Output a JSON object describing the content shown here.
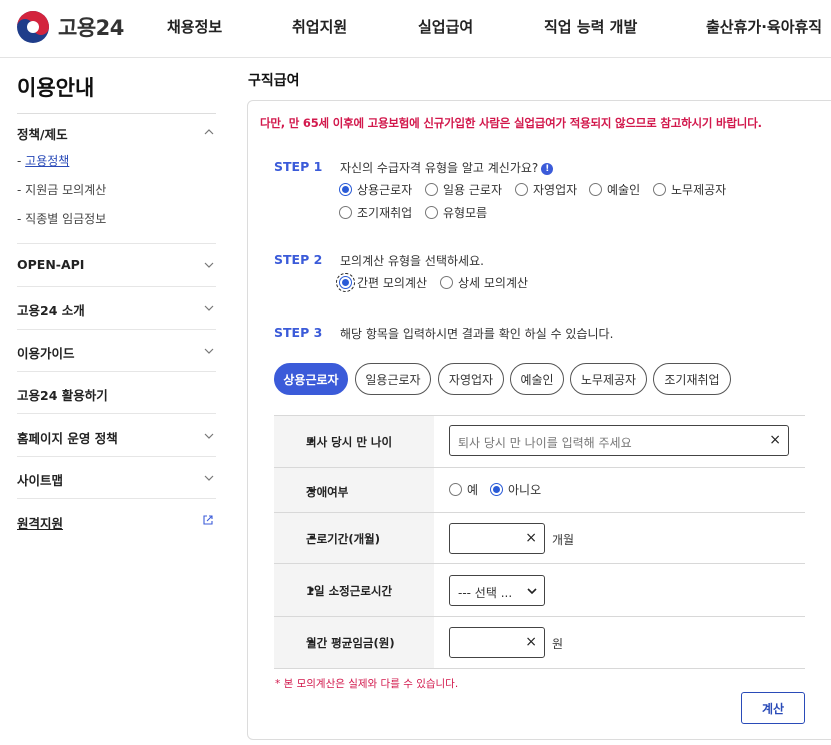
{
  "header": {
    "logo_text": "고용24",
    "nav": [
      "채용정보",
      "취업지원",
      "실업급여",
      "직업 능력 개발",
      "출산휴가·육아휴직"
    ]
  },
  "sidebar": {
    "title": "이용안내",
    "sections": [
      {
        "label": "정책/제도",
        "icon": "chevron-up-icon",
        "subs": [
          "고용정책",
          "지원금 모의계산",
          "직종별 임금정보"
        ]
      },
      {
        "label": "OPEN-API",
        "icon": "chevron-down-icon"
      },
      {
        "label": "고용24 소개",
        "icon": "chevron-down-icon"
      },
      {
        "label": "이용가이드",
        "icon": "chevron-down-icon"
      },
      {
        "label": "고용24 활용하기"
      },
      {
        "label": "홈페이지 운영 정책",
        "icon": "chevron-down-icon"
      },
      {
        "label": "사이트맵",
        "icon": "chevron-down-icon"
      },
      {
        "label": "원격지원",
        "icon": "external-link-icon"
      }
    ],
    "active_sub": "고용정책"
  },
  "main": {
    "title": "구직급여",
    "notice": "다만, 만 65세 이후에 고용보험에 신규가입한 사람은 실업급여가 적용되지 않으므로 참고하시기 바랍니다.",
    "step1": {
      "label": "STEP 1",
      "text": "자신의 수급자격 유형을 알고 계신가요?",
      "info_icon": "!",
      "options": [
        "상용근로자",
        "일용 근로자",
        "자영업자",
        "예술인",
        "노무제공자",
        "조기재취업",
        "유형모름"
      ],
      "selected": "상용근로자"
    },
    "step2": {
      "label": "STEP 2",
      "text": "모의계산 유형을 선택하세요.",
      "options": [
        "간편 모의계산",
        "상세 모의계산"
      ],
      "selected": "간편 모의계산"
    },
    "step3": {
      "label": "STEP 3",
      "text": "해당 항목을 입력하시면 결과를 확인 하실 수 있습니다."
    },
    "tabs": [
      "상용근로자",
      "일용근로자",
      "자영업자",
      "예술인",
      "노무제공자",
      "조기재취업"
    ],
    "active_tab": "상용근로자",
    "form": {
      "age_label": "퇴사 당시 만 나이",
      "age_placeholder": "퇴사 당시 만 나이를 입력해 주세요",
      "disability_label": "장애여부",
      "disability_options": [
        "예",
        "아니오"
      ],
      "disability_selected": "아니오",
      "period_label": "근로기간(개월)",
      "period_unit": "개월",
      "hours_label": "1일 소정근로시간",
      "hours_select": "--- 선택 ...",
      "wage_label": "월간 평균임금(원)",
      "wage_unit": "원",
      "required_mark": "•",
      "clear_icon": "×"
    },
    "footnote": "* 본 모의계산은 실제와 다를 수 있습니다.",
    "calc_button": "계산"
  },
  "colors": {
    "accent": "#3b5bd9",
    "warning": "#d2184c",
    "link": "#2a4bb8"
  }
}
